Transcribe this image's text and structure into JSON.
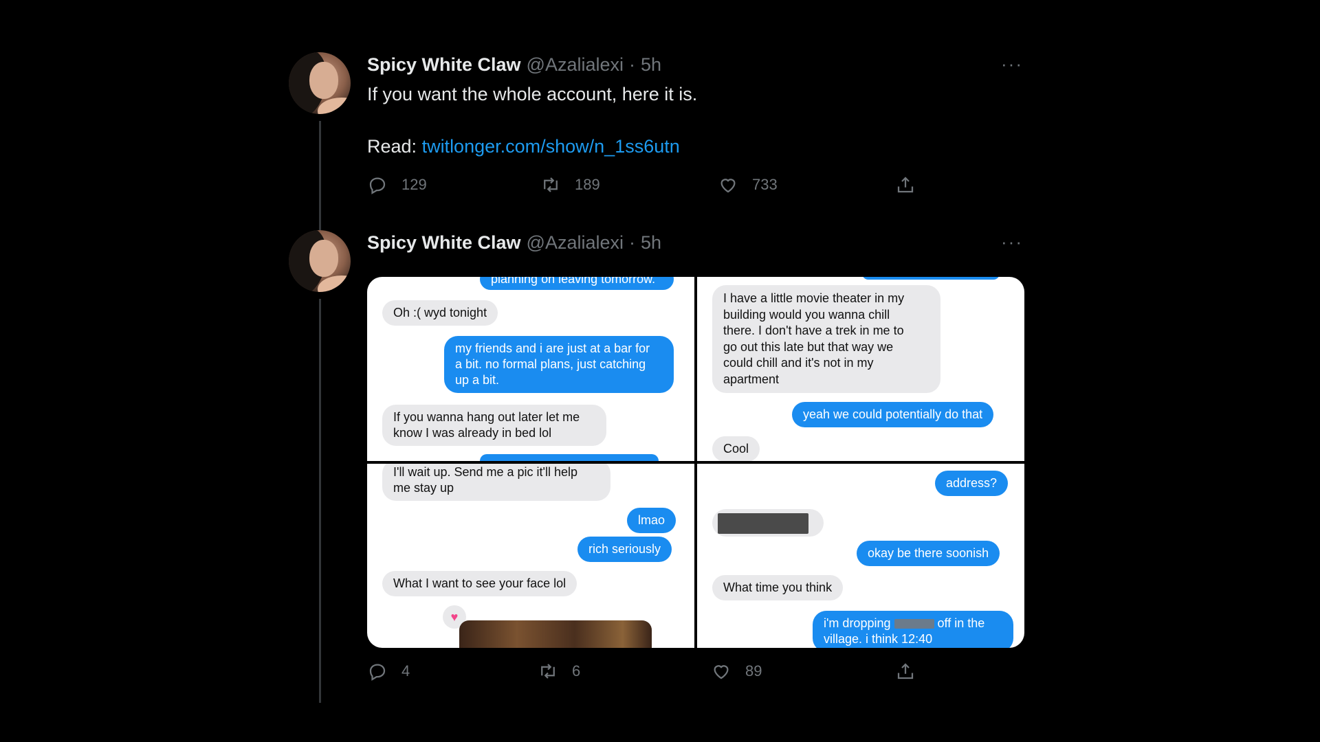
{
  "tweets": [
    {
      "name": "Spicy White Claw",
      "handle": "@Azalialexi",
      "separator": "·",
      "time": "5h",
      "more": "···",
      "text_line1": "If you want the whole account, here it is.",
      "text_line2_prefix": "Read: ",
      "link": "twitlonger.com/show/n_1ss6utn",
      "stats": {
        "replies": "129",
        "retweets": "189",
        "likes": "733"
      }
    },
    {
      "name": "Spicy White Claw",
      "handle": "@Azalialexi",
      "separator": "·",
      "time": "5h",
      "more": "···",
      "stats": {
        "replies": "4",
        "retweets": "6",
        "likes": "89"
      },
      "media": {
        "top_left": [
          "planning on leaving tomorrow.",
          "Oh :( wyd tonight",
          "my friends and i are just at a bar for",
          "a bit. no formal plans, just catching",
          "up a bit.",
          "If you wanna hang out later let me",
          "know I was already in bed lol"
        ],
        "top_right": [
          "I have a little movie theater in my",
          "building would you wanna chill",
          "there. I don't have a trek in me to",
          "go out this late but that way we",
          "could chill and it's not in my",
          "apartment",
          "yeah we could potentially do that",
          "Cool"
        ],
        "bottom_left": [
          "I'll wait up. Send me a pic it'll help",
          "me stay up",
          "lmao",
          "rich seriously",
          "What I want to see your face lol"
        ],
        "bottom_right": [
          "address?",
          "okay be there soonish",
          "What time you think",
          "i'm dropping",
          "off in the",
          "village. i think 12:40"
        ]
      }
    }
  ],
  "icons": [
    "reply-icon",
    "retweet-icon",
    "like-icon",
    "share-icon",
    "more-icon"
  ],
  "colors": {
    "background": "#000000",
    "text": "#e7e9ea",
    "muted": "#71767b",
    "link": "#1d9bf0",
    "bubble_out": "#1a8cf0",
    "bubble_in": "#e9e9eb"
  }
}
